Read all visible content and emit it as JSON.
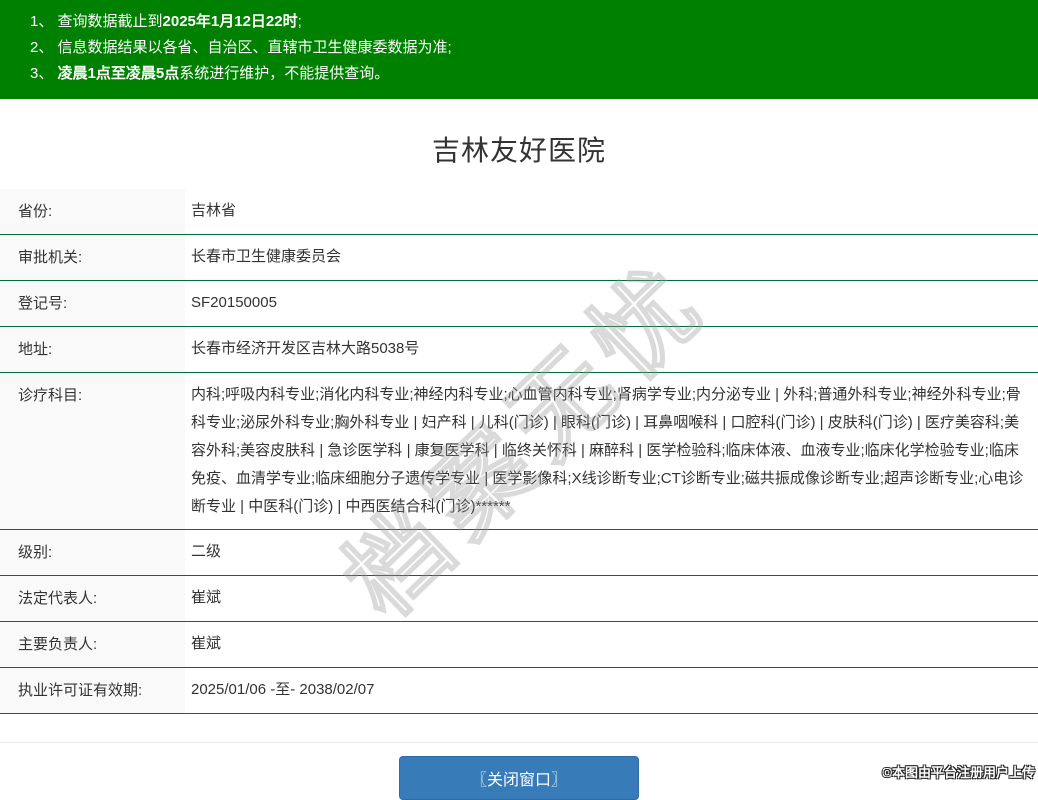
{
  "banner": {
    "notices": [
      {
        "prefix": "1、 查询数据截止到",
        "bold": "2025年1月12日22时",
        "suffix": ";"
      },
      {
        "prefix": "2、 信息数据结果以各省、自治区、直辖市卫生健康委数据为准;",
        "bold": "",
        "suffix": ""
      },
      {
        "prefix": "3、 ",
        "bold": "凌晨1点至凌晨5点",
        "suffix": "系统进行维护，不能提供查询。"
      }
    ]
  },
  "page": {
    "title": "吉林友好医院"
  },
  "info_table": {
    "rows": [
      {
        "label": "省份:",
        "value": "吉林省"
      },
      {
        "label": "审批机关:",
        "value": "长春市卫生健康委员会"
      },
      {
        "label": "登记号:",
        "value": "SF20150005"
      },
      {
        "label": "地址:",
        "value": "长春市经济开发区吉林大路5038号"
      },
      {
        "label": "诊疗科目:",
        "value": "内科;呼吸内科专业;消化内科专业;神经内科专业;心血管内科专业;肾病学专业;内分泌专业 | 外科;普通外科专业;神经外科专业;骨科专业;泌尿外科专业;胸外科专业 | 妇产科 | 儿科(门诊) | 眼科(门诊) | 耳鼻咽喉科 | 口腔科(门诊) | 皮肤科(门诊) | 医疗美容科;美容外科;美容皮肤科 | 急诊医学科 | 康复医学科 | 临终关怀科 | 麻醉科 | 医学检验科;临床体液、血液专业;临床化学检验专业;临床免疫、血清学专业;临床细胞分子遗传学专业 | 医学影像科;X线诊断专业;CT诊断专业;磁共振成像诊断专业;超声诊断专业;心电诊断专业 | 中医科(门诊) | 中西医结合科(门诊)******"
      },
      {
        "label": "级别:",
        "value": "二级"
      },
      {
        "label": "法定代表人:",
        "value": "崔斌"
      },
      {
        "label": "主要负责人:",
        "value": "崔斌"
      },
      {
        "label": "执业许可证有效期:",
        "value": "2025/01/06 -至- 2038/02/07"
      }
    ]
  },
  "footer": {
    "close_button_label": "〖关闭窗口〗"
  },
  "watermarks": {
    "diagonal_text": "档案无忧",
    "corner_text": "©本图由平台注册用户上传"
  },
  "colors": {
    "banner_green": "#008000",
    "row_border_green": "#006e3c",
    "label_bg": "#f9f9f9",
    "button_blue": "#377cb8",
    "text": "#333333"
  }
}
